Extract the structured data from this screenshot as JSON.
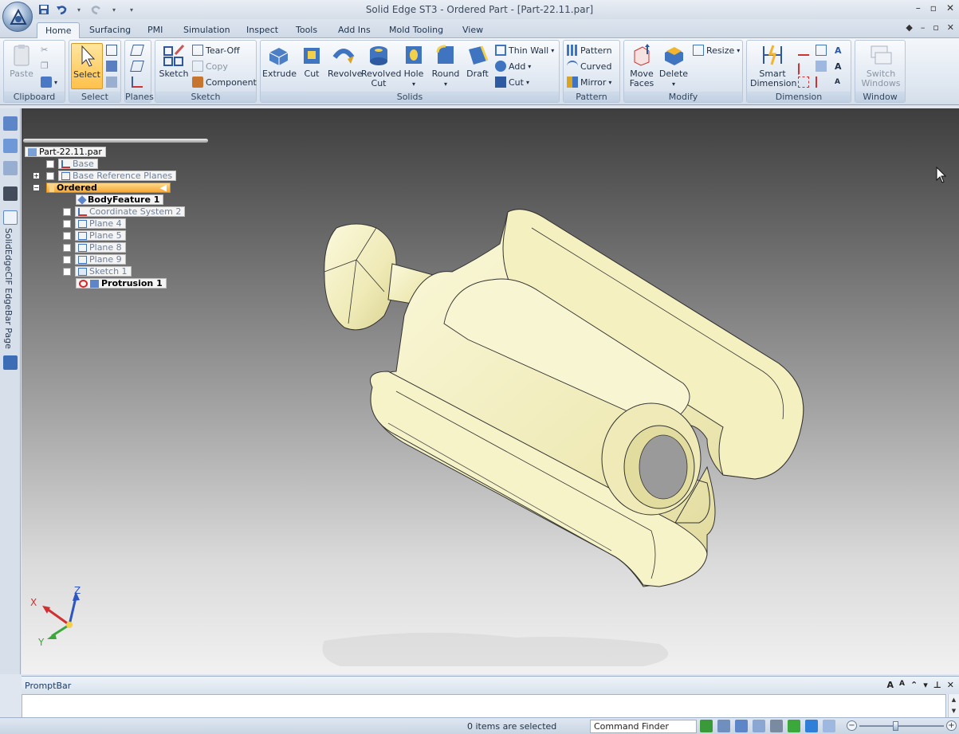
{
  "window": {
    "title": "Solid Edge ST3 - Ordered Part - [Part-22.11.par]",
    "controls": [
      "–",
      "▫",
      "✕"
    ]
  },
  "ribbon_tabs": [
    "Home",
    "Surfacing",
    "PMI",
    "Simulation",
    "Inspect",
    "Tools",
    "Add Ins",
    "Mold Tooling",
    "View"
  ],
  "ribbon": {
    "clipboard": {
      "label": "Clipboard",
      "paste": "Paste"
    },
    "select": {
      "label": "Select",
      "select": "Select"
    },
    "planes": {
      "label": "Planes"
    },
    "sketch": {
      "label": "Sketch",
      "sketch": "Sketch",
      "tear_off": "Tear-Off",
      "copy": "Copy",
      "component": "Component"
    },
    "solids": {
      "label": "Solids",
      "extrude": "Extrude",
      "cut": "Cut",
      "revolve": "Revolve",
      "revolved_cut_1": "Revolved",
      "revolved_cut_2": "Cut",
      "hole": "Hole",
      "round": "Round",
      "draft": "Draft",
      "thin_wall": "Thin Wall",
      "add": "Add",
      "cut_small": "Cut"
    },
    "pattern": {
      "label": "Pattern",
      "pattern": "Pattern",
      "curved": "Curved",
      "mirror": "Mirror"
    },
    "modify": {
      "label": "Modify",
      "move_faces_1": "Move",
      "move_faces_2": "Faces",
      "delete": "Delete",
      "resize": "Resize"
    },
    "dimension": {
      "label": "Dimension",
      "smart_1": "Smart",
      "smart_2": "Dimension"
    },
    "window_group": {
      "label": "Window",
      "switch_1": "Switch",
      "switch_2": "Windows"
    }
  },
  "edgebar": {
    "page_label": "SolidEdgeCIF EdgeBar Page"
  },
  "tree": {
    "root": "Part-22.11.par",
    "base": "Base",
    "base_ref_planes": "Base Reference Planes",
    "ordered": "Ordered",
    "body_feature": "BodyFeature 1",
    "coord_system": "Coordinate System 2",
    "plane4": "Plane 4",
    "plane5": "Plane 5",
    "plane8": "Plane 8",
    "plane9": "Plane 9",
    "sketch1": "Sketch 1",
    "protrusion1": "Protrusion 1"
  },
  "triad": {
    "x": "X",
    "y": "Y",
    "z": "Z"
  },
  "promptbar": {
    "title": "PromptBar",
    "input": ""
  },
  "status": {
    "selection": "0 items are selected",
    "command_finder": "Command Finder",
    "zoom_level": 0.42
  },
  "colors": {
    "part_fill": "#f4f1c0",
    "active_tab": "#f2f6fb",
    "ordered_highlight": "#f6a935"
  }
}
